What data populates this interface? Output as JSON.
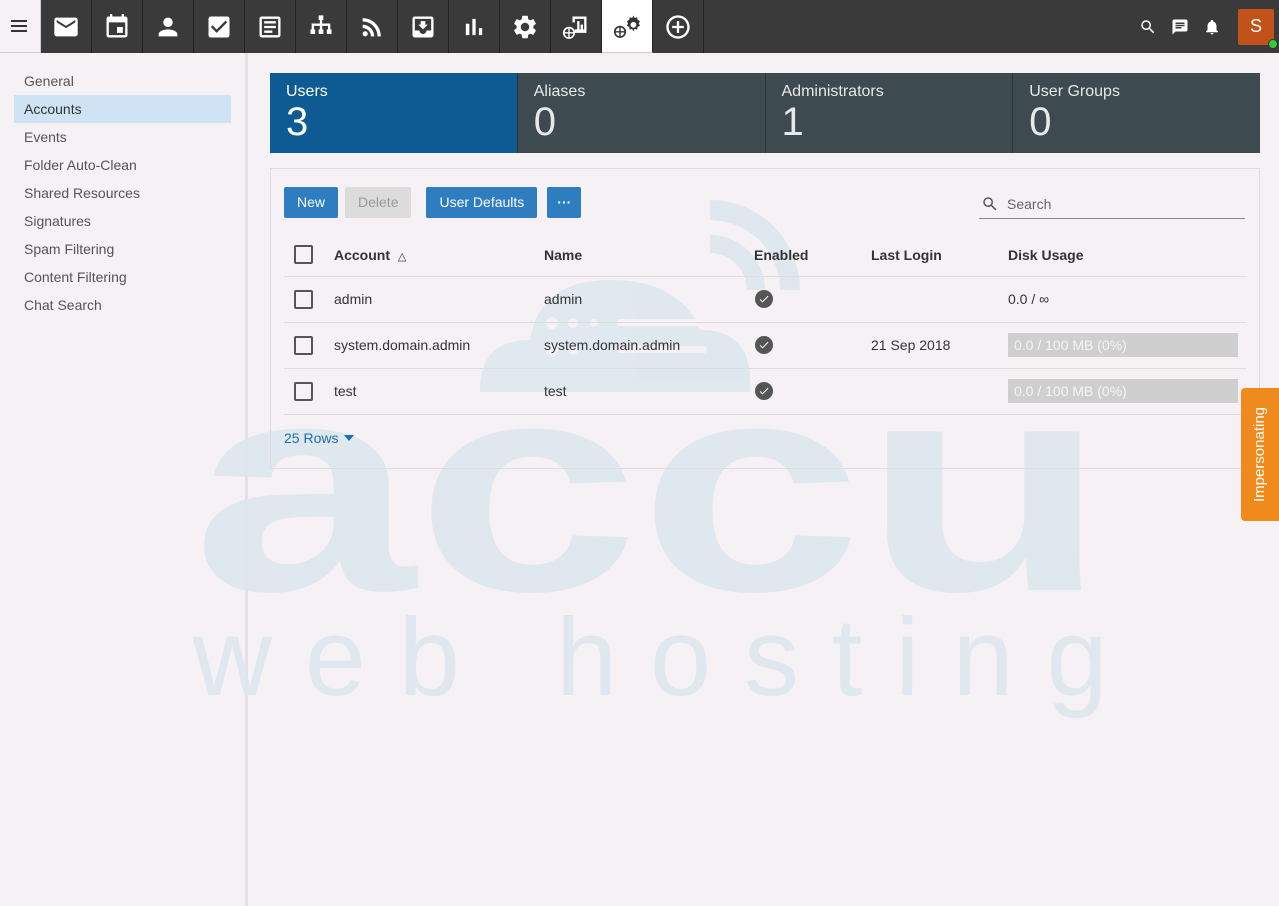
{
  "topbar": {
    "apps": [
      {
        "name": "menu-icon"
      },
      {
        "name": "mail-icon"
      },
      {
        "name": "calendar-icon"
      },
      {
        "name": "contacts-icon"
      },
      {
        "name": "tasks-icon"
      },
      {
        "name": "notes-icon"
      },
      {
        "name": "sitemap-icon"
      },
      {
        "name": "rss-icon"
      },
      {
        "name": "download-icon"
      },
      {
        "name": "reports-icon"
      },
      {
        "name": "settings-icon"
      },
      {
        "name": "domain-reports-icon"
      },
      {
        "name": "domain-settings-icon",
        "active": true
      },
      {
        "name": "add-icon"
      }
    ],
    "avatar_initial": "S",
    "online_color": "#2ecc40"
  },
  "sidebar": {
    "items": [
      {
        "label": "General"
      },
      {
        "label": "Accounts",
        "active": true
      },
      {
        "label": "Events"
      },
      {
        "label": "Folder Auto-Clean"
      },
      {
        "label": "Shared Resources"
      },
      {
        "label": "Signatures"
      },
      {
        "label": "Spam Filtering"
      },
      {
        "label": "Content Filtering"
      },
      {
        "label": "Chat Search"
      }
    ]
  },
  "stats": [
    {
      "label": "Users",
      "value": "3"
    },
    {
      "label": "Aliases",
      "value": "0"
    },
    {
      "label": "Administrators",
      "value": "1"
    },
    {
      "label": "User Groups",
      "value": "0"
    }
  ],
  "toolbar": {
    "new_label": "New",
    "delete_label": "Delete",
    "user_defaults_label": "User Defaults",
    "more_label": "···"
  },
  "search": {
    "placeholder": "Search"
  },
  "table": {
    "headers": {
      "account": "Account",
      "name": "Name",
      "enabled": "Enabled",
      "last_login": "Last Login",
      "disk_usage": "Disk Usage"
    },
    "rows": [
      {
        "account": "admin",
        "name": "admin",
        "enabled": true,
        "last_login": "",
        "disk_usage": "0.0 / ∞",
        "bar": false
      },
      {
        "account": "system.domain.admin",
        "name": "system.domain.admin",
        "enabled": true,
        "last_login": "21 Sep 2018",
        "disk_usage": "0.0 / 100 MB (0%)",
        "bar": true
      },
      {
        "account": "test",
        "name": "test",
        "enabled": true,
        "last_login": "",
        "disk_usage": "0.0 / 100 MB (0%)",
        "bar": true
      }
    ]
  },
  "rows_label": "25 Rows",
  "impersonating_label": "Impersonating",
  "watermark": {
    "line1": "accu",
    "line2": "web hosting"
  },
  "colors": {
    "accent": "#2d7dc0",
    "active_stat": "#0e5b93",
    "stat_bg": "#3d4a50",
    "impersonating": "#f08a1c"
  }
}
